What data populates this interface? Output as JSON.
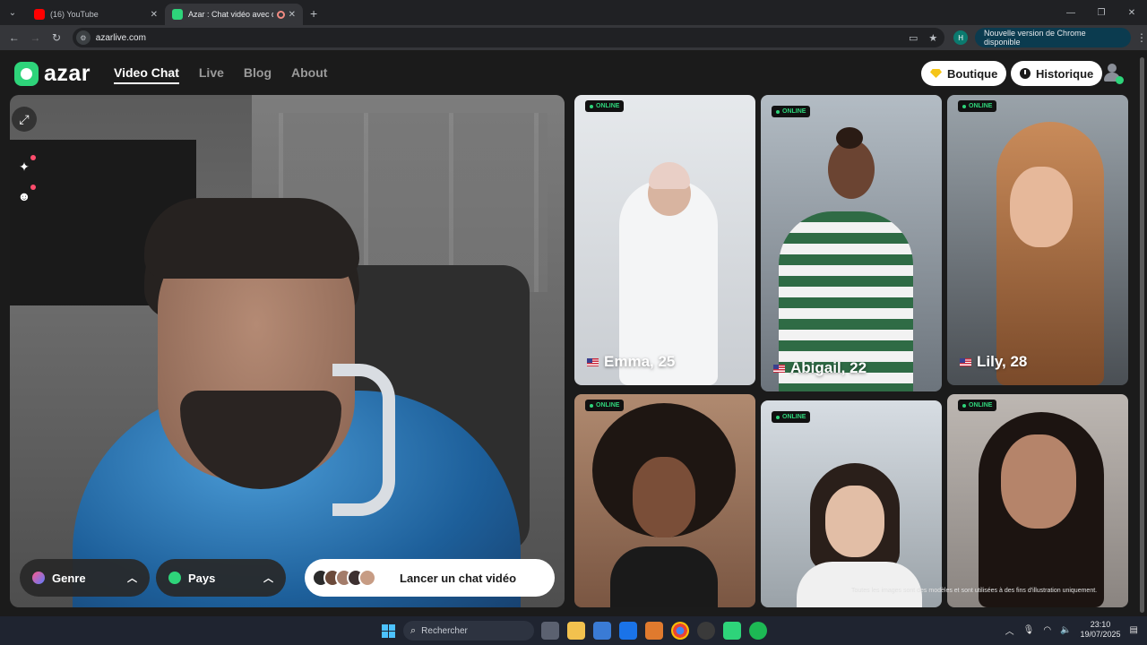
{
  "browser": {
    "tabs": [
      {
        "title": "(16) YouTube",
        "active": false
      },
      {
        "title": "Azar : Chat vidéo avec de n",
        "active": true
      }
    ],
    "url": "azarlive.com",
    "profile_initial": "H",
    "update_label": "Nouvelle version de Chrome disponible"
  },
  "site": {
    "logo_text": "azar",
    "nav": [
      "Video Chat",
      "Live",
      "Blog",
      "About"
    ],
    "active_nav": "Video Chat",
    "boutique_label": "Boutique",
    "historique_label": "Historique"
  },
  "controls": {
    "gender_label": "Genre",
    "country_label": "Pays",
    "start_label": "Lancer un chat vidéo"
  },
  "cards": [
    {
      "status": "ONLINE",
      "name": "Emma, 25"
    },
    {
      "status": "ONLINE",
      "name": "Abigail, 22"
    },
    {
      "status": "ONLINE",
      "name": "Lily, 28"
    },
    {
      "status": "ONLINE",
      "name": ""
    },
    {
      "status": "ONLINE",
      "name": ""
    },
    {
      "status": "ONLINE",
      "name": ""
    }
  ],
  "disclaimer": "Toutes les images sont des modèles et sont utilisées à des fins d'illustration uniquement.",
  "taskbar": {
    "search_placeholder": "Rechercher",
    "time": "23:10",
    "date": "19/07/2025"
  },
  "colors": {
    "brand": "#2ed47a",
    "online": "#2ed47a"
  },
  "icons": [
    "tab-menu-icon",
    "youtube-icon",
    "azar-favicon",
    "record-icon",
    "close-icon",
    "new-tab-icon",
    "back-icon",
    "forward-icon",
    "reload-icon",
    "star-icon",
    "cast-icon",
    "menu-icon",
    "diamond-icon",
    "clock-icon",
    "user-icon",
    "expand-icon",
    "sparkle-icon",
    "face-icon",
    "chevron-up-icon",
    "windows-icon",
    "search-icon"
  ]
}
